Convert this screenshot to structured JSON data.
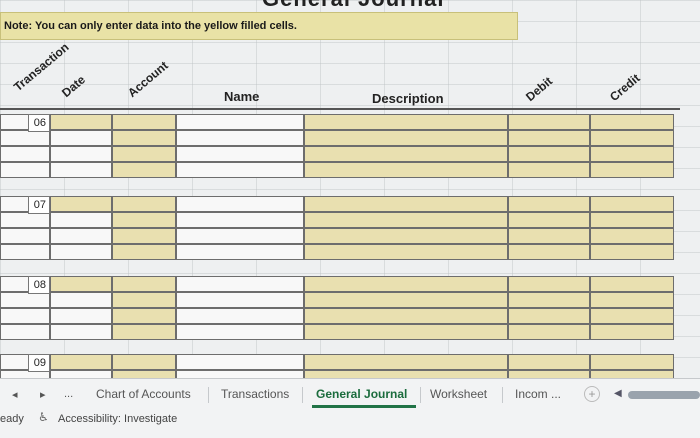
{
  "sheet": {
    "title": "General Journal",
    "note": "Note: You can only enter data into the yellow filled cells."
  },
  "headers": {
    "transaction": "Transaction",
    "date": "Date",
    "account": "Account",
    "name": "Name",
    "description": "Description",
    "debit": "Debit",
    "credit": "Credit"
  },
  "blocks": [
    {
      "number": "06"
    },
    {
      "number": "07"
    },
    {
      "number": "08"
    },
    {
      "number": "09"
    }
  ],
  "tabs": {
    "prev": "◂",
    "next": "▸",
    "more": "...",
    "items": [
      "Chart of Accounts",
      "Transactions",
      "General Journal",
      "Worksheet",
      "Incom ..."
    ],
    "add": "+"
  },
  "status": {
    "ready": "eady",
    "accessibility": "Accessibility: Investigate"
  },
  "colors": {
    "input_yellow": "#e9e0b0",
    "active_tab": "#217346"
  }
}
